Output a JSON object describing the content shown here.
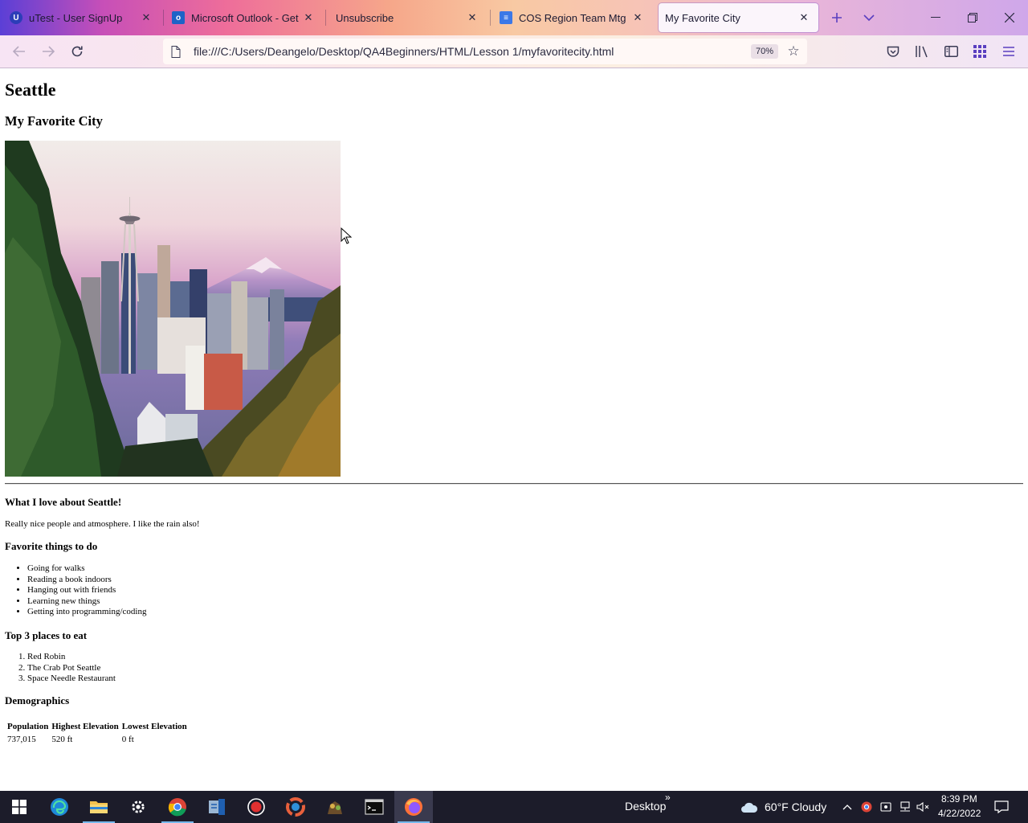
{
  "browser": {
    "tabs": [
      {
        "title": "uTest - User SignUp",
        "icon": "utest-favicon-icon",
        "active": false
      },
      {
        "title": "Microsoft Outlook - Get Out",
        "icon": "outlook-favicon-icon",
        "active": false
      },
      {
        "title": "Unsubscribe",
        "icon": "",
        "active": false
      },
      {
        "title": "COS Region Team Mtg Note",
        "icon": "google-docs-favicon-icon",
        "active": false
      },
      {
        "title": "My Favorite City",
        "icon": "",
        "active": true
      }
    ],
    "url": "file:///C:/Users/Deangelo/Desktop/QA4Beginners/HTML/Lesson 1/myfavoritecity.html",
    "zoom": "70%"
  },
  "page": {
    "title": "Seattle",
    "subtitle": "My Favorite City",
    "image_alt": "Seattle skyline with Space Needle and Mount Rainier",
    "love_heading": "What I love about Seattle!",
    "love_text": "Really nice people and atmosphere. I like the rain also!",
    "things_heading": "Favorite things to do",
    "things": [
      "Going for walks",
      "Reading a book indoors",
      "Hanging out with friends",
      "Learning new things",
      "Getting into programming/coding"
    ],
    "places_heading": "Top 3 places to eat",
    "places": [
      "Red Robin",
      "The Crab Pot Seattle",
      "Space Needle Restaurant"
    ],
    "demo_heading": "Demographics",
    "demo_table": {
      "headers": [
        "Population",
        "Highest Elevation",
        "Lowest Elevation"
      ],
      "rows": [
        [
          "737,015",
          "520 ft",
          "0 ft"
        ]
      ]
    }
  },
  "taskbar": {
    "desktop_label": "Desktop",
    "weather": "60°F  Cloudy",
    "time": "8:39 PM",
    "date": "4/22/2022"
  },
  "colors": {
    "accent": "#7a4fd6",
    "taskbar": "#1c1c2a"
  }
}
